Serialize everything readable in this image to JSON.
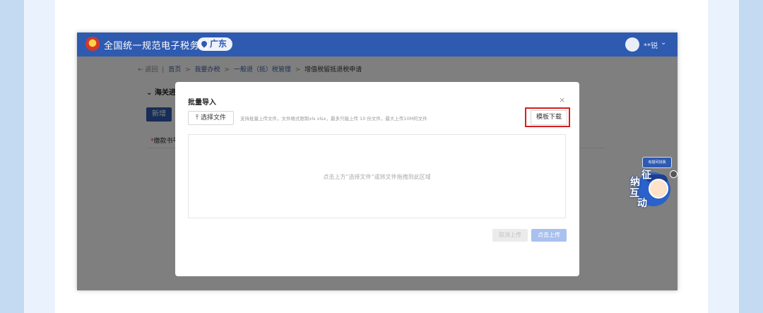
{
  "colors": {
    "brand_blue": "#2e5ab0",
    "highlight_red": "#d81e1e",
    "page_bg": "#d9e8f7"
  },
  "header": {
    "site_title": "全国统一规范电子税务局",
    "region": "广东",
    "user": "**锐",
    "icons": [
      "national-emblem-icon",
      "location-pin-icon",
      "avatar-icon",
      "chevron-down-icon"
    ]
  },
  "page": {
    "back": "返回",
    "breadcrumb": [
      "首页",
      "我要办税",
      "一般退（抵）税管理",
      "增值税留抵退税申请"
    ],
    "section_title": "海关进",
    "add_button": "新增",
    "column_header": "缴款书号"
  },
  "modal": {
    "title": "批量导入",
    "close": "×",
    "select_file_button": "选择文件",
    "tip": "支持批量上传文件，文件格式限制xls xlsx，最多只能上传 10 份文件，最大上传10M的文件",
    "template_button": "模板下载",
    "drop_hint": "点击上方“选择文件”或将文件拖拽到此区域",
    "cancel_upload": "取消上传",
    "click_upload": "点击上传"
  },
  "mascot": {
    "bubble": "有疑问找我",
    "characters": [
      "征",
      "纳",
      "互",
      "动"
    ]
  }
}
